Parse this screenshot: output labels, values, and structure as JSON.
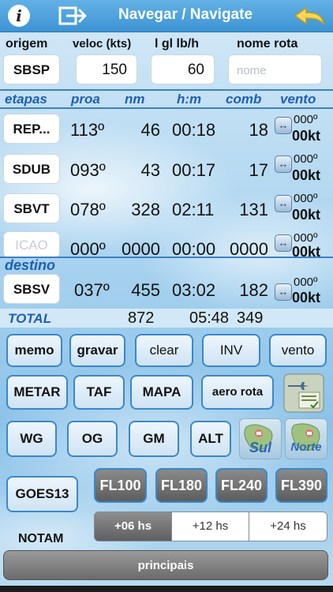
{
  "header": {
    "title": "Navegar / Navigate",
    "info": "i"
  },
  "form": {
    "origin_label": "origem",
    "origin_value": "SBSP",
    "speed_label": "veloc (kts)",
    "speed_value": "150",
    "fuel_label": "l gl lb/h",
    "fuel_value": "60",
    "route_label": "nome rota",
    "route_placeholder": "nome"
  },
  "columns": {
    "legs": "etapas",
    "heading": "proa",
    "nm": "nm",
    "time": "h:m",
    "fuel": "comb",
    "wind": "vento"
  },
  "legs": [
    {
      "code": "REP...",
      "heading": "113º",
      "nm": "46",
      "time": "00:18",
      "fuel": "18",
      "wind_dir": "000º",
      "wind_spd": "00kt"
    },
    {
      "code": "SDUB",
      "heading": "093º",
      "nm": "43",
      "time": "00:17",
      "fuel": "17",
      "wind_dir": "000º",
      "wind_spd": "00kt"
    },
    {
      "code": "SBVT",
      "heading": "078º",
      "nm": "328",
      "time": "02:11",
      "fuel": "131",
      "wind_dir": "000º",
      "wind_spd": "00kt"
    },
    {
      "code": "ICAO",
      "heading": "000º",
      "nm": "0000",
      "time": "00:00",
      "fuel": "0000",
      "wind_dir": "000º",
      "wind_spd": "00kt"
    }
  ],
  "destination": {
    "label": "destino",
    "code": "SBSV",
    "heading": "037º",
    "nm": "455",
    "time": "03:02",
    "fuel": "182",
    "wind_dir": "000º",
    "wind_spd": "00kt"
  },
  "total": {
    "label": "TOTAL",
    "nm": "872",
    "time": "05:48",
    "fuel": "349"
  },
  "buttons": {
    "memo": "memo",
    "gravar": "gravar",
    "clear": "clear",
    "inv": "INV",
    "vento": "vento",
    "metar": "METAR",
    "taf": "TAF",
    "mapa": "MAPA",
    "aero_rota": "aero rota",
    "wg": "WG",
    "og": "OG",
    "gm": "GM",
    "alt": "ALT",
    "sul": "Sul",
    "norte": "Norte",
    "goes13": "GOES13",
    "fl100": "FL100",
    "fl180": "FL180",
    "fl240": "FL240",
    "fl390": "FL390"
  },
  "forecast": {
    "options": [
      "+06 hs",
      "+12 hs",
      "+24 hs"
    ],
    "selected": "+06 hs"
  },
  "notam": "NOTAM",
  "principais": "principais",
  "colors": {
    "topbar": "#3d94d3",
    "accent": "#1f5fb0",
    "button_border": "#3a88c8"
  }
}
